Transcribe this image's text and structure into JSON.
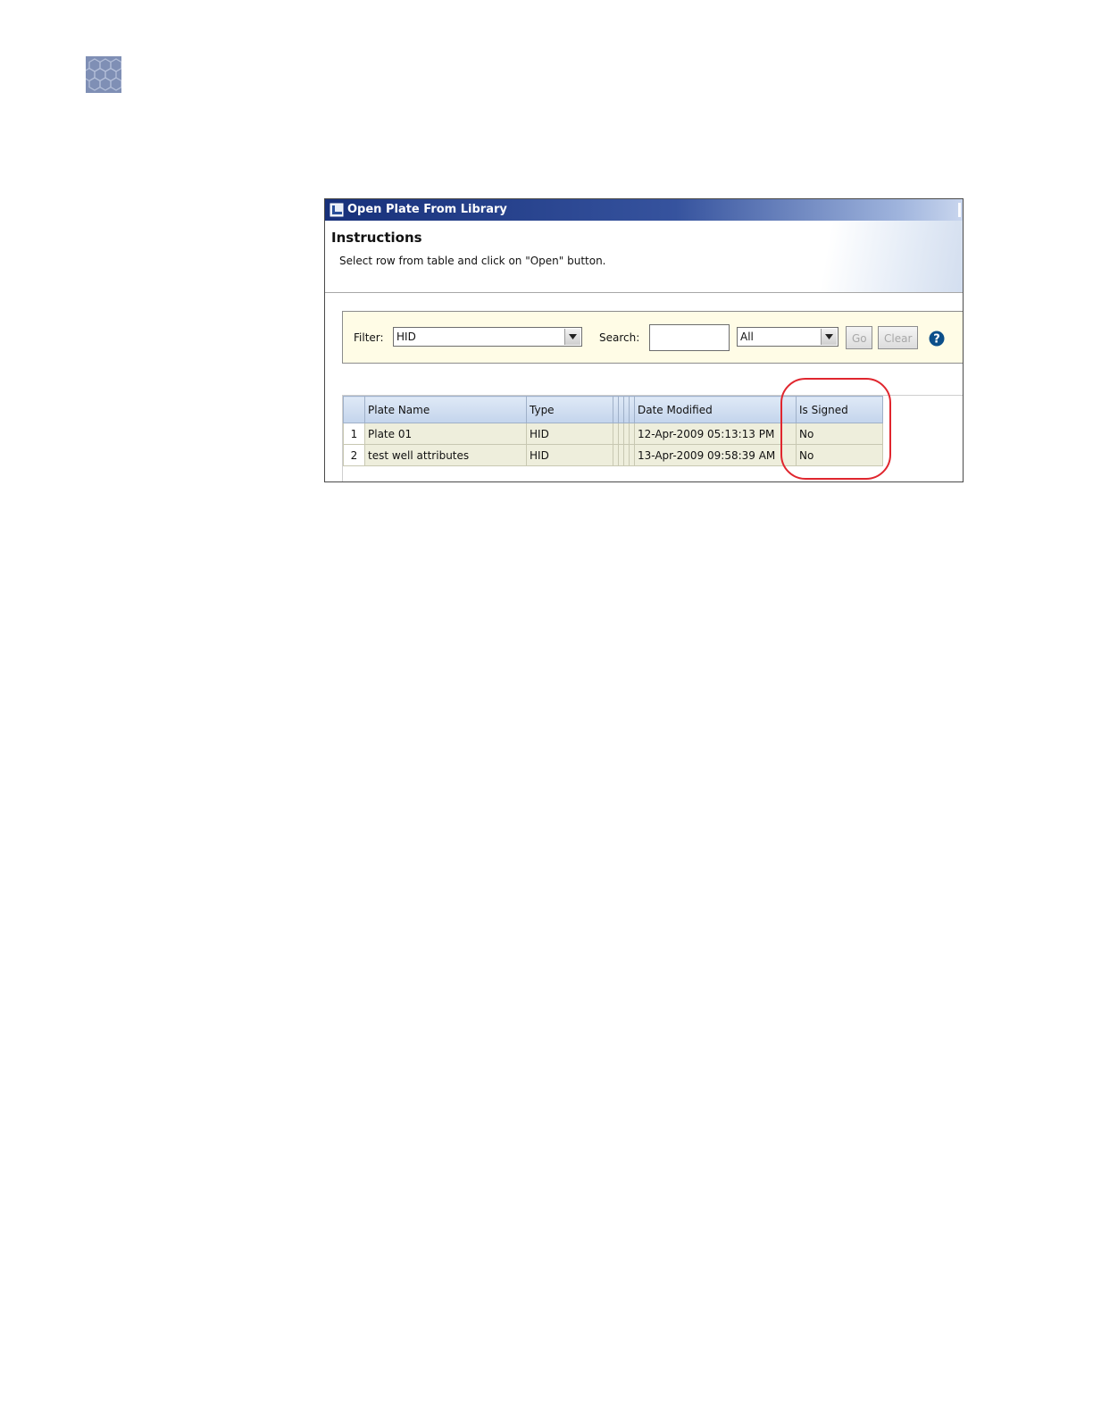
{
  "dialog": {
    "title": "Open Plate From Library",
    "instructions_title": "Instructions",
    "instructions_text": "Select row from table and click on \"Open\" button."
  },
  "filter": {
    "filter_label": "Filter:",
    "filter_value": "HID",
    "search_label": "Search:",
    "search_value": "",
    "scope_value": "All",
    "go_label": "Go",
    "clear_label": "Clear"
  },
  "table": {
    "columns": [
      "Plate Name",
      "Type",
      "Date Modified",
      "Is Signed"
    ],
    "rows": [
      {
        "index": "1",
        "plate_name": "Plate 01",
        "type": "HID",
        "date_modified": "12-Apr-2009 05:13:13 PM",
        "is_signed": "No"
      },
      {
        "index": "2",
        "plate_name": "test well attributes",
        "type": "HID",
        "date_modified": "13-Apr-2009 09:58:39 AM",
        "is_signed": "No"
      }
    ]
  },
  "colors": {
    "titlebar": "#17307a",
    "filter_background": "#fffce6",
    "highlight_ring": "#e0262e",
    "help_icon": "#0c4f8a"
  },
  "icons": [
    "hexagon-pattern-logo-icon",
    "app-window-icon",
    "dropdown-arrow-icon",
    "help-icon"
  ]
}
